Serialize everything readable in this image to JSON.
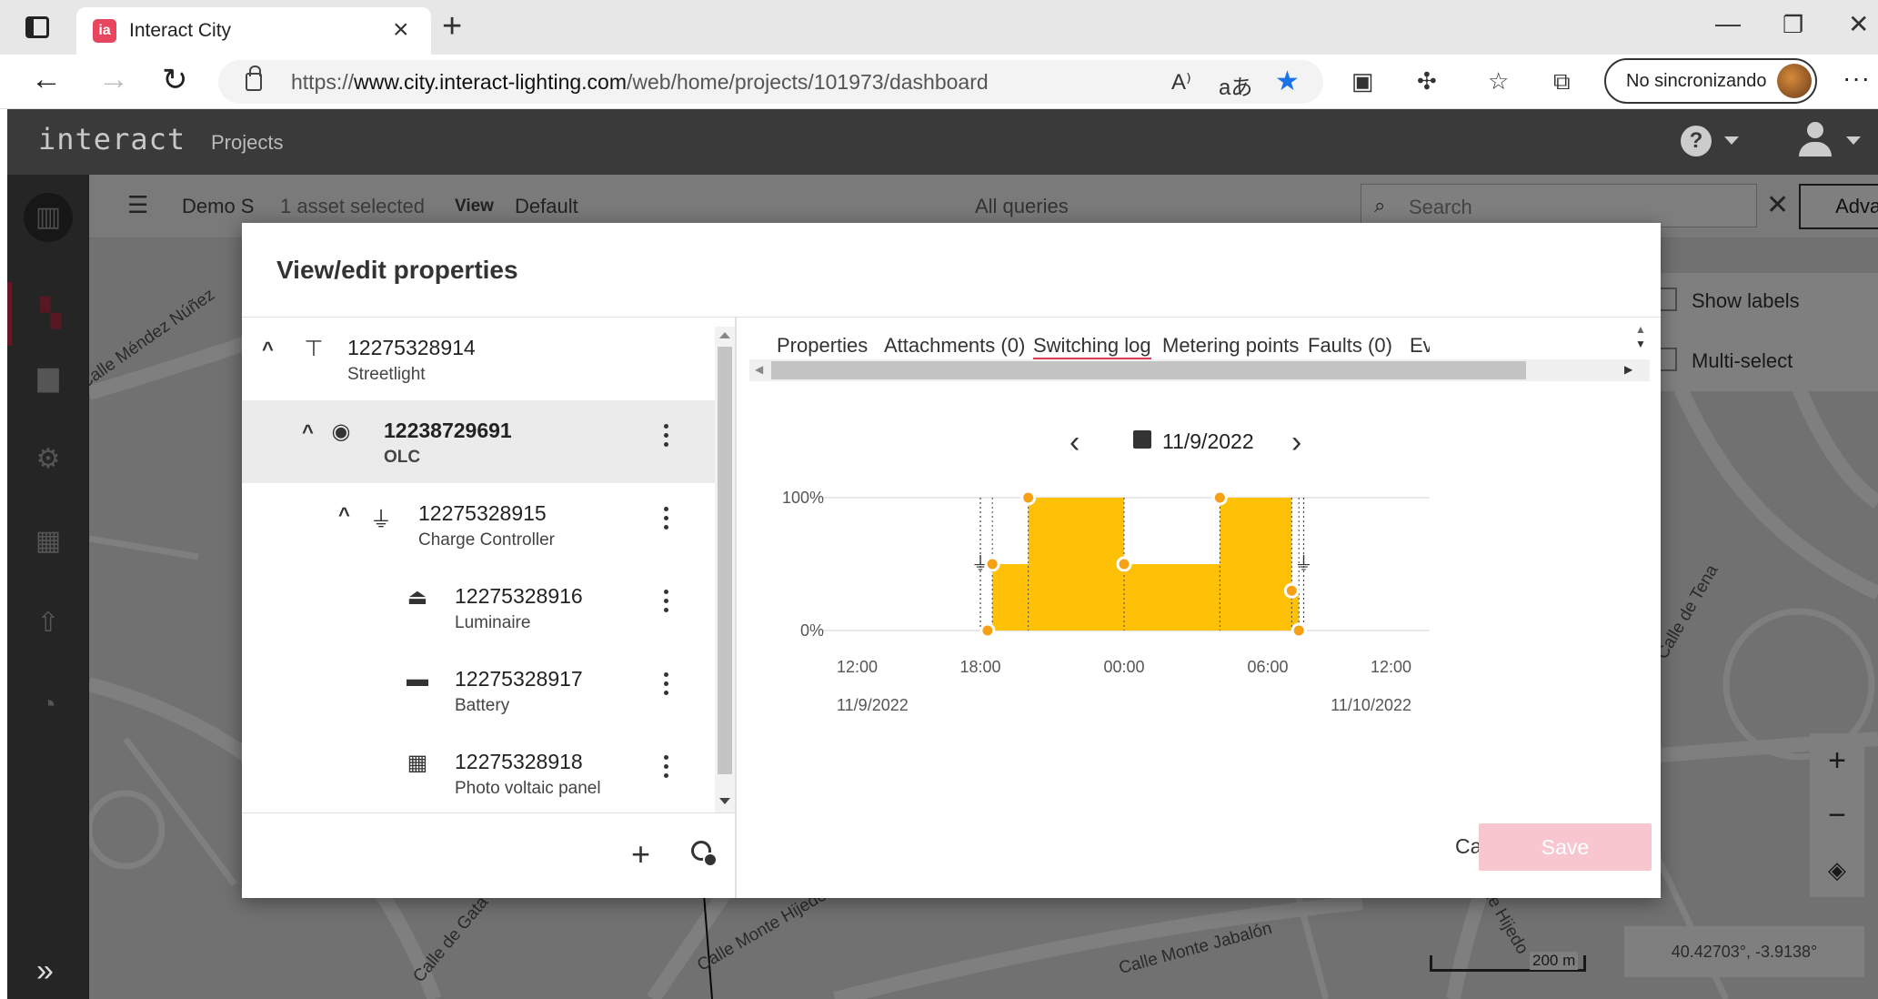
{
  "browser": {
    "tab_title": "Interact City",
    "tab_favicon": "ia",
    "url_prefix": "https://",
    "url_host": "www.city.interact-lighting.com",
    "url_path": "/web/home/projects/101973/dashboard",
    "sync_label": "No sincronizando"
  },
  "app": {
    "logo": "interact",
    "nav_projects": "Projects"
  },
  "map_toolbar": {
    "project_name": "Demo S",
    "selection_count": "1 asset selected",
    "view_label": "View",
    "view_value": "Default",
    "queries_value": "All queries",
    "search_placeholder": "Search",
    "advanced_label": "Advanced"
  },
  "map_panel": {
    "show_labels": "Show labels",
    "multi_select": "Multi-select"
  },
  "map": {
    "coordinates": "40.42703°, -3.9138°",
    "scale": "200 m",
    "streets": [
      "Calle Méndez Núñez",
      "Calle Monte Hijedo",
      "Calle Monte Jabalón",
      "Calle de Gata",
      "Calle de Tena",
      "Calle Hijedo"
    ]
  },
  "modal": {
    "title": "View/edit properties",
    "tree": [
      {
        "id": "12275328914",
        "type": "Streetlight",
        "icon": "streetlight-icon",
        "glyph": "⊤",
        "expanded": true
      },
      {
        "id": "12238729691",
        "type": "OLC",
        "icon": "olc-icon",
        "glyph": "◉",
        "expanded": true,
        "selected": true
      },
      {
        "id": "12275328915",
        "type": "Charge Controller",
        "icon": "charge-controller-icon",
        "glyph": "⏚",
        "expanded": true
      },
      {
        "id": "12275328916",
        "type": "Luminaire",
        "icon": "luminaire-icon",
        "glyph": "⏏"
      },
      {
        "id": "12275328917",
        "type": "Battery",
        "icon": "battery-icon",
        "glyph": "▬"
      },
      {
        "id": "12275328918",
        "type": "Photo voltaic panel",
        "icon": "solar-panel-icon",
        "glyph": "▦"
      }
    ],
    "tabs": [
      "Properties",
      "Attachments (0)",
      "Switching log",
      "Metering points",
      "Faults (0)",
      "Ev"
    ],
    "active_tab": "Switching log",
    "date": "11/9/2022",
    "cancel_label": "Cancel",
    "save_label": "Save"
  },
  "chart_data": {
    "type": "area",
    "title": "",
    "xlabel": "",
    "ylabel": "",
    "y_ticks": [
      "100%",
      "0%"
    ],
    "x_ticks": [
      "12:00",
      "18:00",
      "00:00",
      "06:00",
      "12:00"
    ],
    "x_date_labels": [
      "11/9/2022",
      "11/10/2022"
    ],
    "ylim": [
      0,
      100
    ],
    "x_unit": "hours since 11/9/2022 12:00",
    "series": [
      {
        "x": [
          18.3,
          18.5,
          20.0,
          24.0,
          28.0,
          31.0,
          31.3,
          31.5
        ],
        "y": [
          0,
          50,
          100,
          50,
          100,
          30,
          0,
          0
        ]
      }
    ],
    "markers": [
      {
        "x": 18.3,
        "y": 0
      },
      {
        "x": 18.5,
        "y": 50
      },
      {
        "x": 20.0,
        "y": 100
      },
      {
        "x": 24.0,
        "y": 50
      },
      {
        "x": 28.0,
        "y": 100
      },
      {
        "x": 31.0,
        "y": 30
      },
      {
        "x": 31.3,
        "y": 0
      }
    ],
    "event_lines_x": [
      18.0,
      31.5
    ],
    "fill_color": "#ffc107",
    "marker_color": "#f5a015"
  }
}
